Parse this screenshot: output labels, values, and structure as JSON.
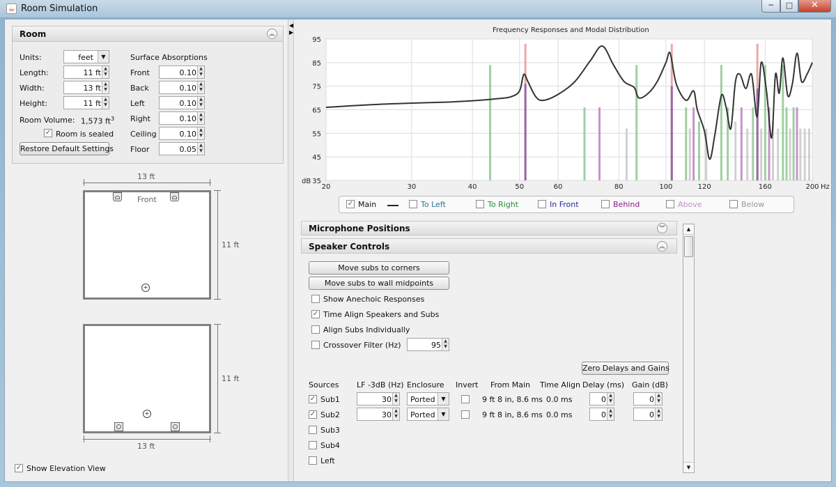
{
  "window": {
    "title": "Room Simulation",
    "icon": "java-icon",
    "minimize": "─",
    "maximize": "□",
    "close": "✕"
  },
  "room": {
    "header": "Room",
    "units_label": "Units:",
    "units_value": "feet",
    "length_label": "Length:",
    "length_value": "11 ft",
    "width_label": "Width:",
    "width_value": "13 ft",
    "height_label": "Height:",
    "height_value": "11 ft",
    "volume_label": "Room Volume:",
    "volume_value": "1,573 ft",
    "volume_exp": "3",
    "sealed_label": "Room is sealed",
    "sealed_checked": true,
    "restore_button": "Restore Default Settings",
    "absorptions_title": "Surface Absorptions",
    "absorptions": [
      {
        "label": "Front",
        "value": "0.10"
      },
      {
        "label": "Back",
        "value": "0.10"
      },
      {
        "label": "Left",
        "value": "0.10"
      },
      {
        "label": "Right",
        "value": "0.10"
      },
      {
        "label": "Ceiling",
        "value": "0.10"
      },
      {
        "label": "Floor",
        "value": "0.05"
      }
    ]
  },
  "plan_view": {
    "width_dim": "13 ft",
    "depth_dim": "11 ft",
    "front_label": "Front"
  },
  "elevation_view": {
    "width_dim": "13 ft",
    "height_dim": "11 ft"
  },
  "show_elevation": {
    "label": "Show Elevation View",
    "checked": true
  },
  "chart_data": {
    "type": "line",
    "title": "Frequency Responses and Modal Distribution",
    "x_scale": "log",
    "xlim": [
      20,
      200
    ],
    "ylim": [
      35,
      95
    ],
    "ylabel_prefix": "dB",
    "x_ticks": [
      "20",
      "30",
      "40",
      "50",
      "60",
      "80",
      "100",
      "120",
      "160",
      "200"
    ],
    "x_unit": "Hz",
    "y_ticks": [
      "35",
      "45",
      "55",
      "65",
      "75",
      "85",
      "95"
    ],
    "grid": true,
    "series": [
      {
        "name": "Main",
        "color": "#333333",
        "x": [
          20,
          25,
          30,
          35,
          40,
          45,
          48,
          50,
          51,
          52,
          54,
          56,
          60,
          65,
          70,
          74,
          78,
          82,
          86,
          88,
          92,
          96,
          100,
          102,
          105,
          110,
          114,
          116,
          120,
          123,
          126,
          130,
          133,
          136,
          139,
          142,
          146,
          150,
          154,
          157,
          161,
          165,
          168,
          171,
          174,
          178,
          182,
          186,
          190,
          195,
          200
        ],
        "y": [
          66,
          67.2,
          67.8,
          68.2,
          68.8,
          69.7,
          70.5,
          73,
          80,
          77,
          70.5,
          69,
          71.5,
          77,
          86,
          92,
          84,
          77,
          74.5,
          70,
          72,
          77,
          85,
          89,
          76,
          69,
          73,
          65,
          56,
          44,
          54,
          71,
          66,
          57,
          77,
          80,
          74,
          80,
          62,
          85,
          73,
          53,
          80,
          72,
          87,
          71,
          76,
          89,
          77,
          80,
          85
        ]
      },
      {
        "name": "To Left",
        "color": "#4a9a9a",
        "x": [],
        "y": []
      },
      {
        "name": "To Right",
        "color": "#3aa04a",
        "x": [],
        "y": []
      },
      {
        "name": "In Front",
        "color": "#3a3aa0",
        "x": [],
        "y": []
      },
      {
        "name": "Behind",
        "color": "#a020a0",
        "x": [],
        "y": []
      },
      {
        "name": "Above",
        "color": "#c080c0",
        "x": [],
        "y": []
      },
      {
        "name": "Below",
        "color": "#999999",
        "x": [],
        "y": []
      }
    ],
    "modes": [
      {
        "f": 43.5,
        "h": 84,
        "c": "#8fc88f"
      },
      {
        "f": 51.4,
        "h": 93,
        "c": "#e89a9a"
      },
      {
        "f": 51.4,
        "h": 76,
        "c": "#8a5aa8"
      },
      {
        "f": 68,
        "h": 66,
        "c": "#8fc88f"
      },
      {
        "f": 73,
        "h": 66,
        "c": "#c080c0"
      },
      {
        "f": 83,
        "h": 57,
        "c": "#c8c8c8"
      },
      {
        "f": 87,
        "h": 84,
        "c": "#8fc88f"
      },
      {
        "f": 102.8,
        "h": 93,
        "c": "#e89a9a"
      },
      {
        "f": 102.8,
        "h": 75,
        "c": "#8a5aa8"
      },
      {
        "f": 110,
        "h": 66,
        "c": "#8fc88f"
      },
      {
        "f": 112,
        "h": 57,
        "c": "#c8c8c8"
      },
      {
        "f": 114,
        "h": 66,
        "c": "#c080c0"
      },
      {
        "f": 117,
        "h": 60,
        "c": "#8fc88f"
      },
      {
        "f": 121,
        "h": 57,
        "c": "#c8c8c8"
      },
      {
        "f": 130,
        "h": 84,
        "c": "#8fc88f"
      },
      {
        "f": 134,
        "h": 66,
        "c": "#8fc88f"
      },
      {
        "f": 139,
        "h": 60,
        "c": "#c8c8c8"
      },
      {
        "f": 143,
        "h": 66,
        "c": "#c080c0"
      },
      {
        "f": 147,
        "h": 57,
        "c": "#c8c8c8"
      },
      {
        "f": 151,
        "h": 66,
        "c": "#8fc88f"
      },
      {
        "f": 154.2,
        "h": 93,
        "c": "#e89a9a"
      },
      {
        "f": 154.2,
        "h": 74,
        "c": "#8a5aa8"
      },
      {
        "f": 157,
        "h": 57,
        "c": "#c8c8c8"
      },
      {
        "f": 160,
        "h": 84,
        "c": "#8fc88f"
      },
      {
        "f": 163,
        "h": 66,
        "c": "#c080c0"
      },
      {
        "f": 166,
        "h": 60,
        "c": "#c8c8c8"
      },
      {
        "f": 170,
        "h": 57,
        "c": "#c8c8c8"
      },
      {
        "f": 174,
        "h": 84,
        "c": "#8fc88f"
      },
      {
        "f": 177,
        "h": 66,
        "c": "#8fc88f"
      },
      {
        "f": 180,
        "h": 57,
        "c": "#c8c8c8"
      },
      {
        "f": 183,
        "h": 66,
        "c": "#8fc88f"
      },
      {
        "f": 186,
        "h": 66,
        "c": "#c080c0"
      },
      {
        "f": 189,
        "h": 57,
        "c": "#c8c8c8"
      },
      {
        "f": 193,
        "h": 57,
        "c": "#c8c8c8"
      },
      {
        "f": 197,
        "h": 57,
        "c": "#c8c8c8"
      }
    ]
  },
  "legend": [
    {
      "label": "Main",
      "checked": true,
      "color": "#111111",
      "line": true
    },
    {
      "label": "To Left",
      "checked": false,
      "color": "#2a7a8a"
    },
    {
      "label": "To Right",
      "checked": false,
      "color": "#2a8a3a"
    },
    {
      "label": "In Front",
      "checked": false,
      "color": "#2a2a9a"
    },
    {
      "label": "Behind",
      "checked": false,
      "color": "#8a1a8a"
    },
    {
      "label": "Above",
      "checked": false,
      "color": "#c090c0"
    },
    {
      "label": "Below",
      "checked": false,
      "color": "#999999"
    }
  ],
  "mic_section": {
    "title": "Microphone Positions"
  },
  "speaker_controls": {
    "title": "Speaker Controls",
    "move_corners": "Move subs to corners",
    "move_midpoints": "Move subs to wall midpoints",
    "show_anechoic": {
      "label": "Show Anechoic Responses",
      "checked": false
    },
    "time_align": {
      "label": "Time Align Speakers and Subs",
      "checked": true
    },
    "align_individually": {
      "label": "Align Subs Individually",
      "checked": false
    },
    "crossover": {
      "label": "Crossover Filter (Hz)",
      "checked": false,
      "value": "95"
    },
    "zero_button": "Zero Delays and Gains",
    "columns": [
      "Sources",
      "LF -3dB (Hz)",
      "Enclosure",
      "Invert",
      "From Main",
      "Time Align",
      "Delay (ms)",
      "Gain (dB)"
    ],
    "sources": [
      {
        "name": "Sub1",
        "checked": true,
        "lf": "30",
        "enclosure": "Ported",
        "invert": false,
        "from_main": "9 ft 8 in, 8.6 ms",
        "time_align": "0.0 ms",
        "delay": "0",
        "gain": "0"
      },
      {
        "name": "Sub2",
        "checked": true,
        "lf": "30",
        "enclosure": "Ported",
        "invert": false,
        "from_main": "9 ft 8 in, 8.6 ms",
        "time_align": "0.0 ms",
        "delay": "0",
        "gain": "0"
      },
      {
        "name": "Sub3",
        "checked": false
      },
      {
        "name": "Sub4",
        "checked": false
      },
      {
        "name": "Left",
        "checked": false
      }
    ]
  }
}
